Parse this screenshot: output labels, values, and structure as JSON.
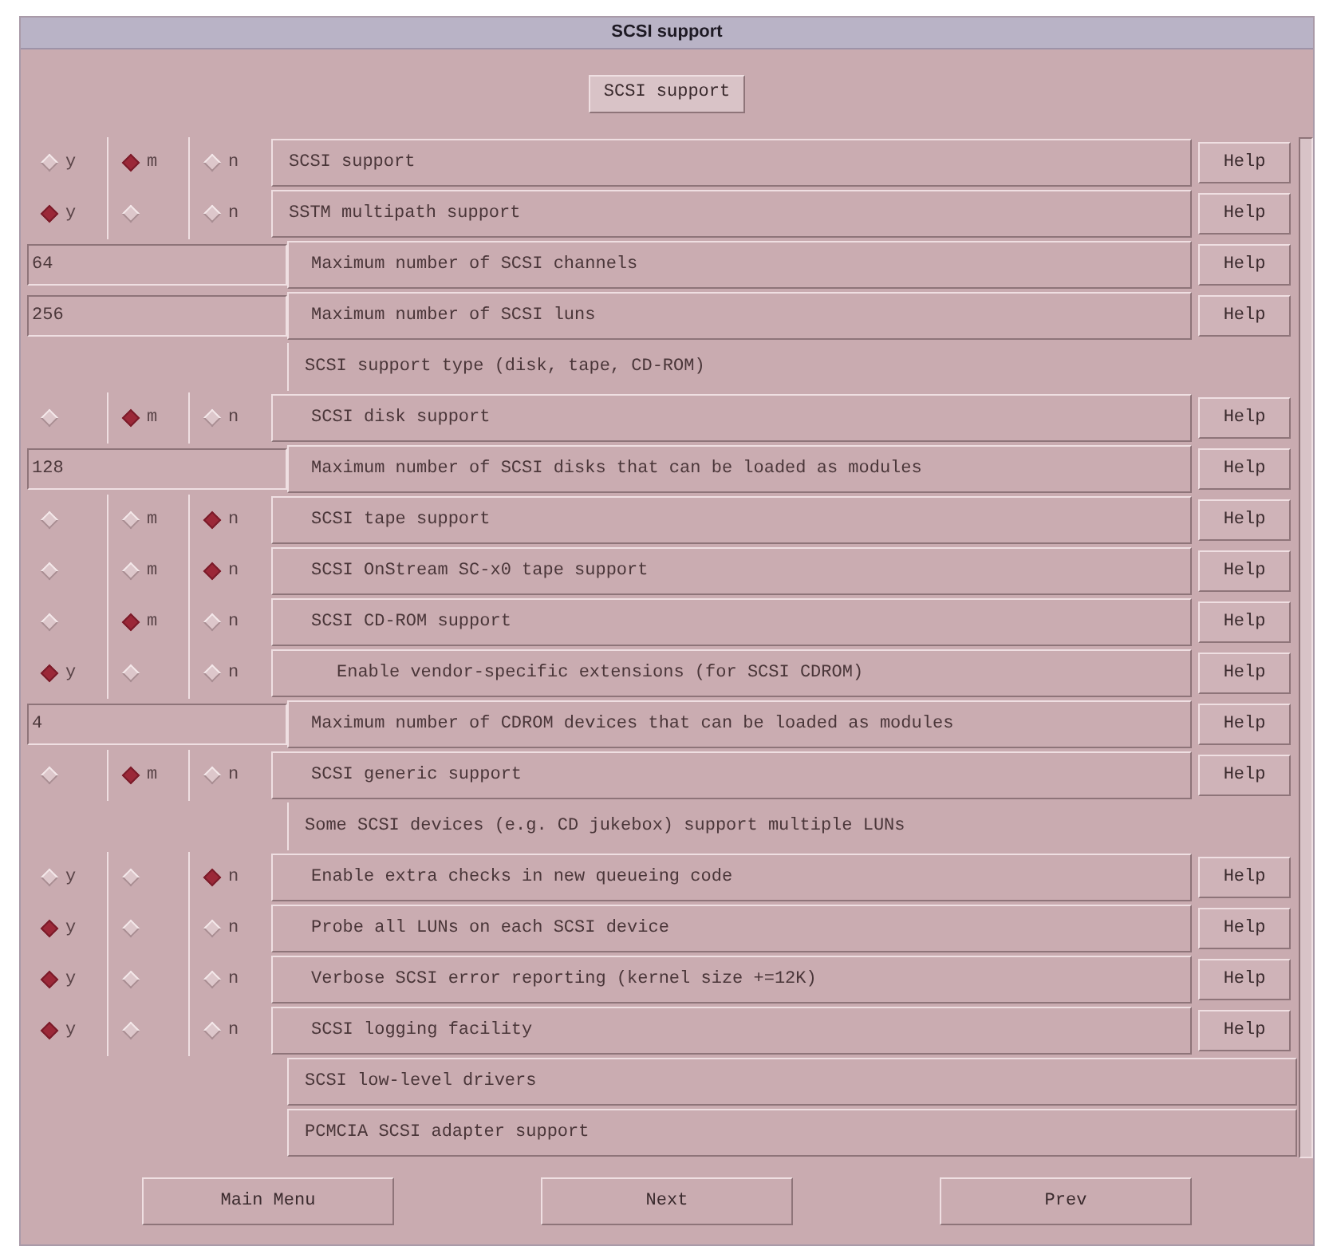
{
  "window": {
    "title": "SCSI support"
  },
  "header_button": "SCSI support",
  "rows": [
    {
      "kind": "tristate",
      "label": "SCSI support",
      "options": [
        {
          "label": "y",
          "selected": false
        },
        {
          "label": "m",
          "selected": true
        },
        {
          "label": "n",
          "selected": false
        }
      ],
      "help": "Help"
    },
    {
      "kind": "tristate",
      "label": "SSTM multipath support",
      "options": [
        {
          "label": "y",
          "selected": true
        },
        {
          "selected": false
        },
        {
          "label": "n",
          "selected": false
        }
      ],
      "help": "Help"
    },
    {
      "kind": "number",
      "value": "64",
      "label": "Maximum number of SCSI channels",
      "help": "Help"
    },
    {
      "kind": "number",
      "value": "256",
      "label": "Maximum number of SCSI luns",
      "help": "Help"
    },
    {
      "kind": "comment",
      "label": "SCSI support type (disk, tape, CD-ROM)",
      "children": [
        {
          "kind": "tristate",
          "label": "SCSI disk support",
          "options": [
            {
              "selected": false
            },
            {
              "label": "m",
              "selected": true
            },
            {
              "label": "n",
              "selected": false
            }
          ],
          "help": "Help"
        },
        {
          "kind": "number",
          "value": "128",
          "label": "Maximum number of SCSI disks that can be loaded as modules",
          "help": "Help"
        },
        {
          "kind": "tristate",
          "label": "SCSI tape support",
          "options": [
            {
              "selected": false
            },
            {
              "label": "m",
              "selected": false
            },
            {
              "label": "n",
              "selected": true
            }
          ],
          "help": "Help"
        },
        {
          "kind": "tristate",
          "label": "SCSI OnStream SC-x0 tape support",
          "options": [
            {
              "selected": false
            },
            {
              "label": "m",
              "selected": false
            },
            {
              "label": "n",
              "selected": true
            }
          ],
          "help": "Help"
        },
        {
          "kind": "tristate",
          "label": "SCSI CD-ROM support",
          "options": [
            {
              "selected": false
            },
            {
              "label": "m",
              "selected": true
            },
            {
              "label": "n",
              "selected": false
            }
          ],
          "help": "Help",
          "children": [
            {
              "kind": "tristate",
              "label": "Enable vendor-specific extensions (for SCSI CDROM)",
              "options": [
                {
                  "label": "y",
                  "selected": true
                },
                {
                  "selected": false
                },
                {
                  "label": "n",
                  "selected": false
                }
              ],
              "help": "Help"
            }
          ]
        },
        {
          "kind": "number",
          "value": "4",
          "label": "Maximum number of CDROM devices that can be loaded as modules",
          "help": "Help"
        },
        {
          "kind": "tristate",
          "label": "SCSI generic support",
          "options": [
            {
              "selected": false
            },
            {
              "label": "m",
              "selected": true
            },
            {
              "label": "n",
              "selected": false
            }
          ],
          "help": "Help"
        }
      ]
    },
    {
      "kind": "comment",
      "label": "Some SCSI devices (e.g. CD jukebox) support multiple LUNs",
      "children": [
        {
          "kind": "tristate",
          "label": "Enable extra checks in new queueing code",
          "options": [
            {
              "label": "y",
              "selected": false
            },
            {
              "selected": false
            },
            {
              "label": "n",
              "selected": true
            }
          ],
          "help": "Help"
        },
        {
          "kind": "tristate",
          "label": "Probe all LUNs on each SCSI device",
          "options": [
            {
              "label": "y",
              "selected": true
            },
            {
              "selected": false
            },
            {
              "label": "n",
              "selected": false
            }
          ],
          "help": "Help"
        },
        {
          "kind": "tristate",
          "label": "Verbose SCSI error reporting (kernel size +=12K)",
          "options": [
            {
              "label": "y",
              "selected": true
            },
            {
              "selected": false
            },
            {
              "label": "n",
              "selected": false
            }
          ],
          "help": "Help"
        },
        {
          "kind": "tristate",
          "label": "SCSI logging facility",
          "options": [
            {
              "label": "y",
              "selected": true
            },
            {
              "selected": false
            },
            {
              "label": "n",
              "selected": false
            }
          ],
          "help": "Help"
        }
      ]
    },
    {
      "kind": "submenu",
      "label": "SCSI low-level drivers"
    },
    {
      "kind": "submenu",
      "label": "PCMCIA SCSI adapter support"
    }
  ],
  "footer_buttons": [
    "Main Menu",
    "Next",
    "Prev"
  ]
}
